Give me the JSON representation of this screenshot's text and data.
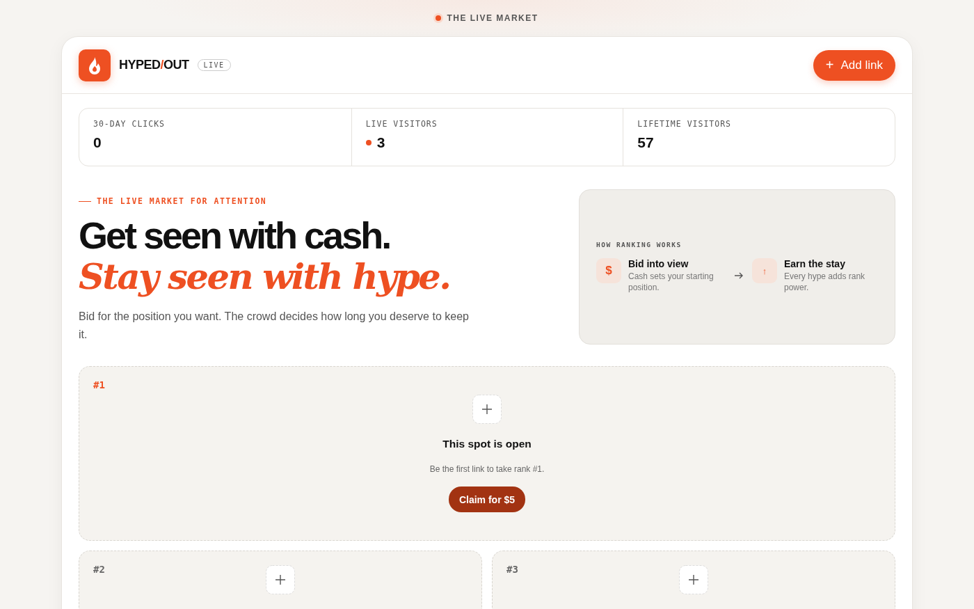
{
  "topbar": {
    "label": "THE LIVE MARKET",
    "live": true
  },
  "brand": {
    "left": "HYPED",
    "separator": "/",
    "right": "OUT",
    "badge": "LIVE"
  },
  "add_button": {
    "icon": "+",
    "label": "Add link"
  },
  "stats": [
    {
      "label": "30-DAY CLICKS",
      "value": "0",
      "live": false
    },
    {
      "label": "LIVE VISITORS",
      "value": "3",
      "live": true
    },
    {
      "label": "LIFETIME VISITORS",
      "value": "57",
      "live": false
    }
  ],
  "hero": {
    "eyebrow": "THE LIVE MARKET FOR ATTENTION",
    "headline": "Get seen with cash.",
    "headline_accent": "Stay seen with hype.",
    "intro": "Bid for the position you want. The crowd decides how long you deserve to keep it."
  },
  "ranking": {
    "title": "HOW RANKING WORKS",
    "steps": [
      {
        "kind": "cash",
        "icon": "$",
        "title": "Bid into view",
        "text": "Cash sets your starting position."
      },
      {
        "kind": "hype",
        "icon": "↑",
        "title": "Earn the stay",
        "text": "Every hype adds rank power."
      }
    ]
  },
  "spots": [
    {
      "rank": "#1",
      "featured": true,
      "title": "This spot is open",
      "note": "Be the first link to take rank #1.",
      "button": "Claim for $5"
    },
    {
      "rank": "#2",
      "featured": false
    },
    {
      "rank": "#3",
      "featured": false
    }
  ]
}
